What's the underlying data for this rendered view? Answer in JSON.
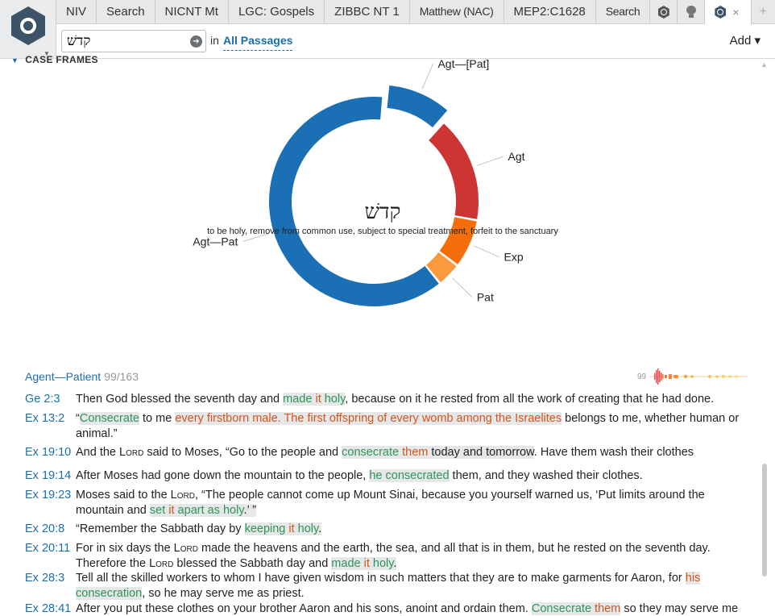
{
  "tabs": [
    {
      "label": "NIV"
    },
    {
      "label": "Search"
    },
    {
      "label": "NICNT Mt"
    },
    {
      "label": "LGC: Gospels"
    },
    {
      "label": "ZIBBC NT 1"
    },
    {
      "label": "Matthew (NAC)"
    },
    {
      "label": "MEP2:C1628"
    },
    {
      "label": "Search"
    }
  ],
  "tab_icons": [
    "hexagon-logo-icon",
    "lightbulb-icon",
    "hexagon-logo-icon",
    "close-icon",
    "plus-icon"
  ],
  "tab_close": "×",
  "tab_plus": "+",
  "search": {
    "query": "קדשׁ",
    "in_label": "in",
    "scope": "All Passages",
    "add_label": "Add ▾",
    "go_icon": "➔"
  },
  "section": {
    "title": "CASE FRAMES"
  },
  "chart_data": {
    "type": "pie",
    "style": "donut",
    "center_word": "קדשׁ",
    "center_definition": "to be holy, remove from common use, subject to special treatment, forfeit to the sanctuary",
    "labels": [
      "Agt—Pat",
      "Agt—[Pat]",
      "Agt",
      "Exp",
      "Pat"
    ],
    "values": [
      99,
      16,
      26,
      12,
      6
    ],
    "colors": [
      "#1b6fb5",
      "#1b6fb5",
      "#cd3534",
      "#f46f0c",
      "#fb9a3c"
    ],
    "exploded": "Agt—[Pat]"
  },
  "group": {
    "name": "Agent—Patient",
    "count": "99/163",
    "spark_count": "99"
  },
  "accent_colors": {
    "link": "#1b6fa8",
    "agent": "#2e9458",
    "patient": "#d2561d"
  }
}
